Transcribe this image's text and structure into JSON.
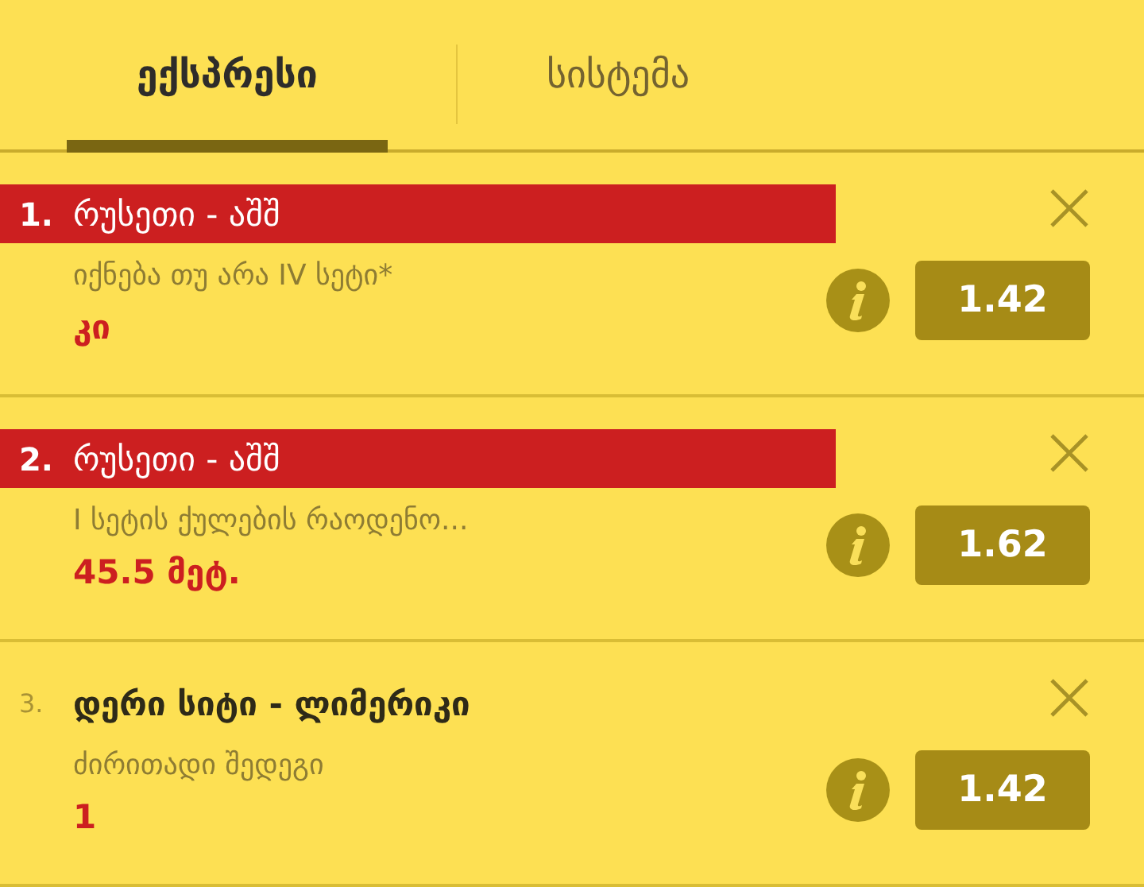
{
  "tabs": [
    {
      "label": "ექსპრესი",
      "selected": true
    },
    {
      "label": "სისტემა",
      "selected": false
    }
  ],
  "bets": [
    {
      "number": "1.",
      "event": "რუსეთი - აშშ",
      "highlighted": true,
      "market": "იქნება თუ არა IV სეტი*",
      "pick": "კი",
      "odds": "1.42"
    },
    {
      "number": "2.",
      "event": "რუსეთი - აშშ",
      "highlighted": true,
      "market": "I სეტის ქულების რაოდენო...",
      "pick": "45.5 მეტ.",
      "odds": "1.62"
    },
    {
      "number": "3.",
      "event": "დერი სიტი - ლიმერიკი",
      "highlighted": false,
      "market": "ძირითადი შედეგი",
      "pick": "1",
      "odds": "1.42"
    }
  ]
}
